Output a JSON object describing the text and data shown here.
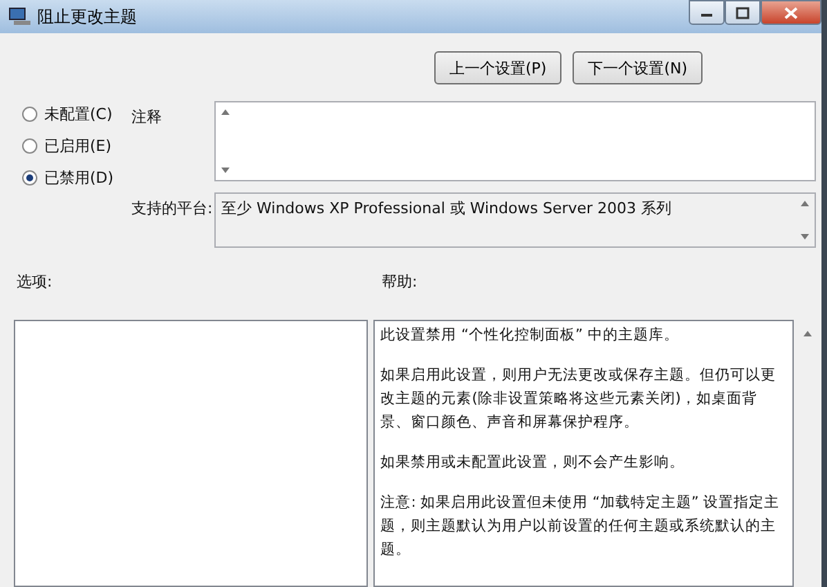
{
  "window": {
    "title": "阻止更改主题"
  },
  "nav_buttons": [
    "上一个设置(P)",
    "下一个设置(N)"
  ],
  "states": [
    {
      "label": "未配置(C)",
      "selected": false
    },
    {
      "label": "已启用(E)",
      "selected": false
    },
    {
      "label": "已禁用(D)",
      "selected": true
    }
  ],
  "comment": {
    "label": "注释"
  },
  "platform": {
    "label": "支持的平台:",
    "value": "至少 Windows XP Professional 或 Windows Server 2003 系列"
  },
  "options": {
    "label": "选项:"
  },
  "help": {
    "label": "帮助:",
    "paragraphs": [
      "此设置禁用 “个性化控制面板” 中的主题库。",
      "如果启用此设置，则用户无法更改或保存主题。但仍可以更改主题的元素(除非设置策略将这些元素关闭)，如桌面背景、窗口颜色、声音和屏幕保护程序。",
      "如果禁用或未配置此设置，则不会产生影响。",
      "注意: 如果启用此设置但未使用 “加载特定主题” 设置指定主题，则主题默认为用户以前设置的任何主题或系统默认的主题。"
    ]
  }
}
